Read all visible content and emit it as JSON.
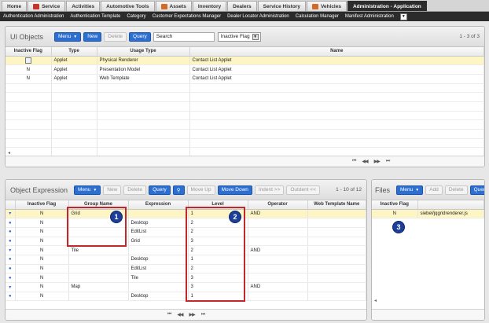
{
  "tabs": [
    {
      "label": "Home",
      "icon": "",
      "active": false
    },
    {
      "label": "Service",
      "icon": "truck-icon",
      "active": false
    },
    {
      "label": "Activities",
      "icon": "",
      "active": false
    },
    {
      "label": "Automotive Tools",
      "icon": "",
      "active": false
    },
    {
      "label": "Assets",
      "icon": "car-icon",
      "active": false
    },
    {
      "label": "Inventory",
      "icon": "",
      "active": false
    },
    {
      "label": "Dealers",
      "icon": "",
      "active": false
    },
    {
      "label": "Service History",
      "icon": "",
      "active": false
    },
    {
      "label": "Vehicles",
      "icon": "car-icon",
      "active": false
    },
    {
      "label": "Administration - Application",
      "icon": "",
      "active": true
    }
  ],
  "subnav": [
    "Authentication Administration",
    "Authentication Template",
    "Category",
    "Customer Expectations Manager",
    "Dealer Locator Administration",
    "Calculation Manager",
    "Manifest Administration"
  ],
  "subnav_more": "▼",
  "ui_objects": {
    "title": "UI Objects",
    "buttons": {
      "menu": "Menu",
      "new": "New",
      "delete": "Delete",
      "query": "Query"
    },
    "search_value": "Search",
    "filter_select": "Inactive Flag",
    "count": "1 - 3 of 3",
    "columns": [
      "Inactive Flag",
      "Type",
      "Usage Type",
      "Name"
    ],
    "rows": [
      {
        "flag": "",
        "type": "Applet",
        "usage": "Physical Renderer",
        "name": "Contact List Applet"
      },
      {
        "flag": "N",
        "type": "Applet",
        "usage": "Presentation Model",
        "name": "Contact List Applet"
      },
      {
        "flag": "N",
        "type": "Applet",
        "usage": "Web Template",
        "name": "Contact List Applet"
      }
    ],
    "nav": {
      "first": "⏮",
      "prev": "◀◀",
      "next": "▶▶",
      "last": "⏭"
    }
  },
  "object_expression": {
    "title": "Object Expression",
    "buttons": {
      "menu": "Menu",
      "new": "New",
      "delete": "Delete",
      "query": "Query",
      "move_up": "Move Up",
      "move_down": "Move Down",
      "indent": "Indent >>",
      "outdent": "Outdent <<"
    },
    "count": "1 - 10 of 12",
    "columns": [
      "",
      "Inactive Flag",
      "Group Name",
      "Expression",
      "Level",
      "Operator",
      "Web Template Name"
    ],
    "rows": [
      {
        "marker": "▾",
        "flag": "N",
        "group": "Grid",
        "expr": "",
        "level": "1",
        "op": "AND",
        "tpl": "",
        "sel": true
      },
      {
        "marker": "●",
        "flag": "N",
        "group": "",
        "expr": "Desktop",
        "level": "2",
        "op": "",
        "tpl": "",
        "sel": false
      },
      {
        "marker": "●",
        "flag": "N",
        "group": "",
        "expr": "EditList",
        "level": "2",
        "op": "",
        "tpl": "",
        "sel": false
      },
      {
        "marker": "●",
        "flag": "N",
        "group": "",
        "expr": "Grid",
        "level": "3",
        "op": "",
        "tpl": "",
        "sel": false
      },
      {
        "marker": "▾",
        "flag": "N",
        "group": "Tile",
        "expr": "",
        "level": "2",
        "op": "AND",
        "tpl": "",
        "sel": false
      },
      {
        "marker": "●",
        "flag": "N",
        "group": "",
        "expr": "Desktop",
        "level": "1",
        "op": "",
        "tpl": "",
        "sel": false
      },
      {
        "marker": "●",
        "flag": "N",
        "group": "",
        "expr": "EditList",
        "level": "2",
        "op": "",
        "tpl": "",
        "sel": false
      },
      {
        "marker": "●",
        "flag": "N",
        "group": "",
        "expr": "Tile",
        "level": "3",
        "op": "",
        "tpl": "",
        "sel": false
      },
      {
        "marker": "▾",
        "flag": "N",
        "group": "Map",
        "expr": "",
        "level": "3",
        "op": "AND",
        "tpl": "",
        "sel": false
      },
      {
        "marker": "●",
        "flag": "N",
        "group": "",
        "expr": "Desktop",
        "level": "1",
        "op": "",
        "tpl": "",
        "sel": false
      }
    ],
    "nav": {
      "first": "⏮",
      "prev": "◀◀",
      "next": "▶▶",
      "last": "⏭"
    }
  },
  "files": {
    "title": "Files",
    "buttons": {
      "menu": "Menu",
      "add": "Add",
      "delete": "Delete",
      "query": "Query"
    },
    "columns": [
      "Inactive Flag",
      ""
    ],
    "rows": [
      {
        "flag": "N",
        "name": "siebel/jqgridrenderer.js",
        "sel": true
      }
    ]
  },
  "callouts": [
    "1",
    "2",
    "3"
  ],
  "colors": {
    "accent": "#2d6fd0",
    "selected_row": "#fdf6c4",
    "callout": "#1d3f9a",
    "highlight_box": "#c0282d"
  }
}
